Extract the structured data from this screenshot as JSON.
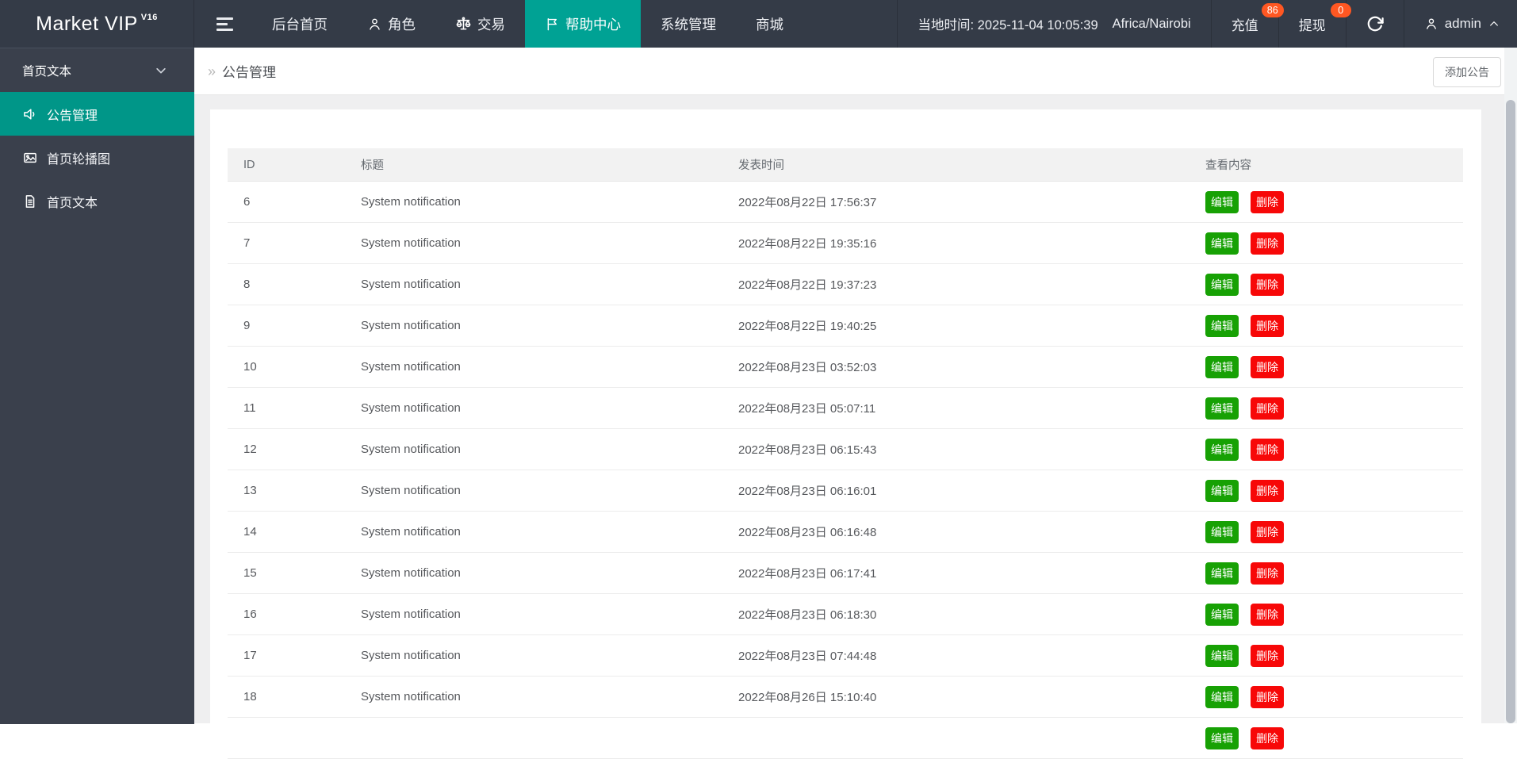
{
  "navbar": {
    "brand": "Market VIP",
    "brand_sup": "V16",
    "menu": [
      {
        "label": "后台首页"
      },
      {
        "label": "角色"
      },
      {
        "label": "交易"
      },
      {
        "label": "帮助中心",
        "active": true
      },
      {
        "label": "系统管理"
      },
      {
        "label": "商城"
      }
    ],
    "local_time": "当地时间: 2025-11-04 10:05:39",
    "timezone": "Africa/Nairobi",
    "recharge_label": "充值",
    "recharge_badge": "86",
    "withdraw_label": "提现",
    "withdraw_badge": "0",
    "username": "admin"
  },
  "sidebar": {
    "group_label": "首页文本",
    "items": [
      {
        "label": "公告管理",
        "active": true
      },
      {
        "label": "首页轮播图"
      },
      {
        "label": "首页文本"
      }
    ]
  },
  "page": {
    "breadcrumb": "公告管理",
    "add_button": "添加公告"
  },
  "table": {
    "columns": [
      "ID",
      "标题",
      "发表时间",
      "查看内容"
    ],
    "actions": {
      "edit": "编辑",
      "delete": "删除"
    },
    "rows": [
      {
        "id": "6",
        "title": "System notification",
        "time": "2022年08月22日 17:56:37"
      },
      {
        "id": "7",
        "title": "System notification",
        "time": "2022年08月22日 19:35:16"
      },
      {
        "id": "8",
        "title": "System notification",
        "time": "2022年08月22日 19:37:23"
      },
      {
        "id": "9",
        "title": "System notification",
        "time": "2022年08月22日 19:40:25"
      },
      {
        "id": "10",
        "title": "System notification",
        "time": "2022年08月23日 03:52:03"
      },
      {
        "id": "11",
        "title": "System notification",
        "time": "2022年08月23日 05:07:11"
      },
      {
        "id": "12",
        "title": "System notification",
        "time": "2022年08月23日 06:15:43"
      },
      {
        "id": "13",
        "title": "System notification",
        "time": "2022年08月23日 06:16:01"
      },
      {
        "id": "14",
        "title": "System notification",
        "time": "2022年08月23日 06:16:48"
      },
      {
        "id": "15",
        "title": "System notification",
        "time": "2022年08月23日 06:17:41"
      },
      {
        "id": "16",
        "title": "System notification",
        "time": "2022年08月23日 06:18:30"
      },
      {
        "id": "17",
        "title": "System notification",
        "time": "2022年08月23日 07:44:48"
      },
      {
        "id": "18",
        "title": "System notification",
        "time": "2022年08月26日 15:10:40"
      }
    ],
    "partial_row_visible": true
  },
  "colors": {
    "nav_bg": "#343b47",
    "side_bg": "#3a404c",
    "nav_active": "#00a294",
    "sidebar_active": "#009688",
    "badge": "#ff5722",
    "edit_button": "#17a104",
    "delete_button": "#f70808"
  }
}
